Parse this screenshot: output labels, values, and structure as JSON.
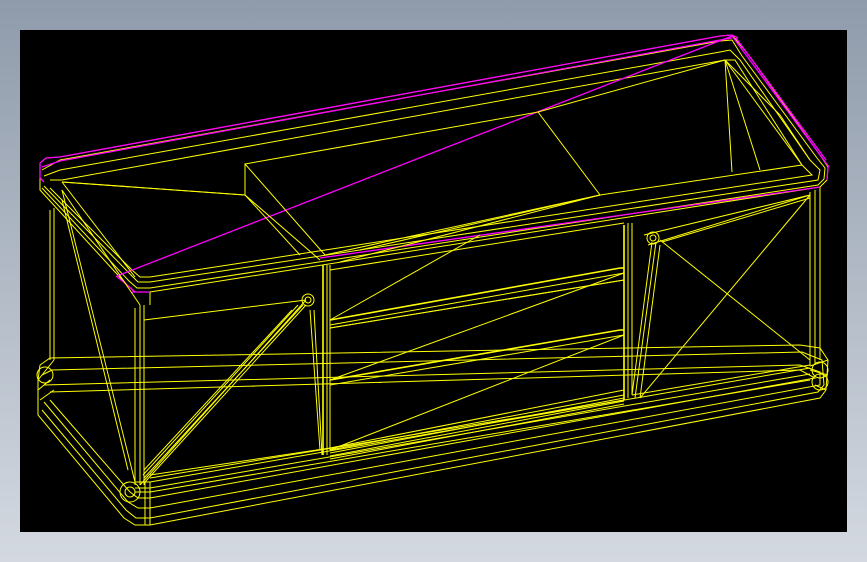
{
  "colors": {
    "background_top": "#8f9bab",
    "background_bottom": "#d4d9e1",
    "viewport": "#000000",
    "wireframe": "#ffff00",
    "highlight_edge": "#ff00ff"
  },
  "view": {
    "render_mode": "wireframe",
    "subject": "cabinet"
  }
}
